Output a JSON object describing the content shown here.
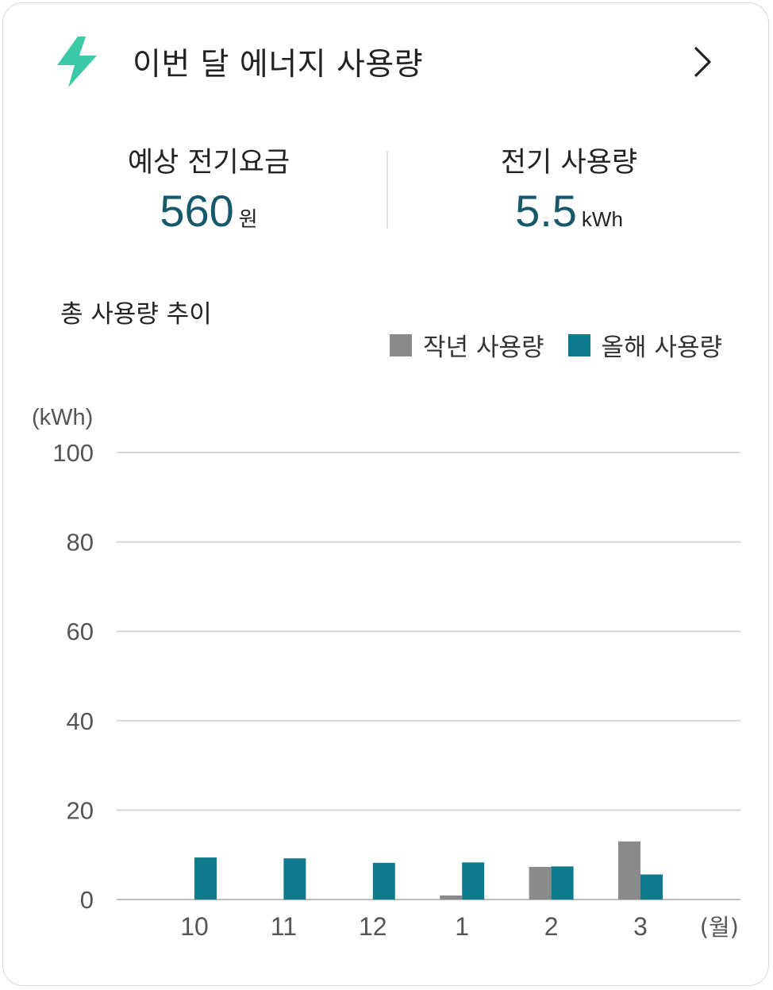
{
  "header": {
    "title": "이번 달 에너지 사용량",
    "icon": "lightning-bolt-icon",
    "accent_color": "#3cc9a8"
  },
  "stats": {
    "fee_label": "예상 전기요금",
    "fee_value": "560",
    "fee_unit": "원",
    "usage_label": "전기 사용량",
    "usage_value": "5.5",
    "usage_unit": "kWh",
    "value_color": "#17596a"
  },
  "trend": {
    "title": "총 사용량 추이"
  },
  "chart_data": {
    "type": "bar",
    "ylabel": "(kWh)",
    "xlabel": "(월)",
    "ylim": [
      0,
      100
    ],
    "yticks": [
      "0",
      "20",
      "40",
      "60",
      "80",
      "100"
    ],
    "grid": true,
    "legend_position": "top-right",
    "categories": [
      "10",
      "11",
      "12",
      "1",
      "2",
      "3"
    ],
    "series": [
      {
        "name": "작년 사용량",
        "color": "#8a8a8a",
        "values": [
          0,
          0,
          0,
          0.9,
          7.3,
          13
        ]
      },
      {
        "name": "올해 사용량",
        "color": "#0e7a8c",
        "values": [
          9.4,
          9.2,
          8.2,
          8.3,
          7.4,
          5.6
        ]
      }
    ]
  }
}
